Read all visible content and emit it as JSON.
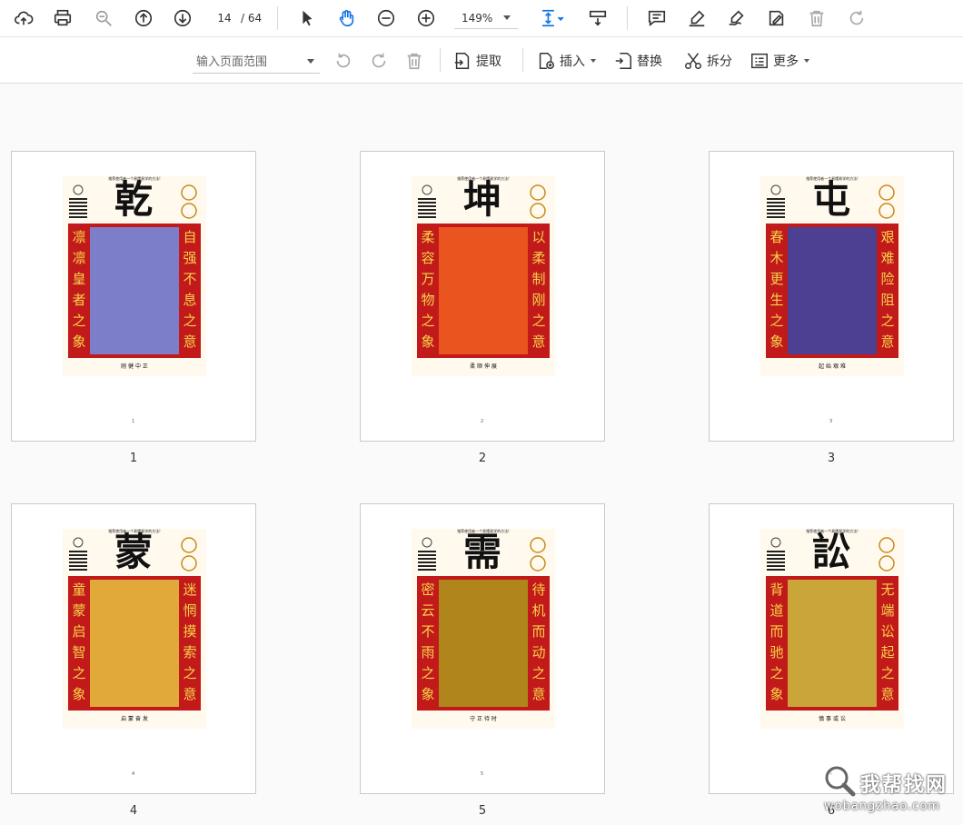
{
  "toolbar": {
    "page_current": "14",
    "page_total": "/ 64",
    "zoom": "149%"
  },
  "edit_toolbar": {
    "range_placeholder": "输入页面范围",
    "extract": "提取",
    "insert": "插入",
    "replace": "替换",
    "split": "拆分",
    "more": "更多"
  },
  "thumbnails": [
    {
      "label": "1",
      "top_text": "推荐使用者一个易懂易学的方法!",
      "big": "乾",
      "left": [
        "凛",
        "凛",
        "皇",
        "者",
        "之",
        "象"
      ],
      "right": [
        "自",
        "强",
        "不",
        "息",
        "之",
        "意"
      ],
      "bottom": "刚 健 中 正",
      "tiny": "1",
      "scene_color": "#7d7ec9"
    },
    {
      "label": "2",
      "top_text": "推荐使用者一个易懂易学的方法!",
      "big": "坤",
      "left": [
        "柔",
        "容",
        "万",
        "物",
        "之",
        "象"
      ],
      "right": [
        "以",
        "柔",
        "制",
        "刚",
        "之",
        "意"
      ],
      "bottom": "柔 顺 伸 展",
      "tiny": "2",
      "scene_color": "#e9541f"
    },
    {
      "label": "3",
      "top_text": "推荐使用者一个易懂易学的方法!",
      "big": "屯",
      "left": [
        "春",
        "木",
        "更",
        "生",
        "之",
        "象"
      ],
      "right": [
        "艰",
        "难",
        "险",
        "阻",
        "之",
        "意"
      ],
      "bottom": "起 始 艰 难",
      "tiny": "3",
      "scene_color": "#4d3f91"
    },
    {
      "label": "4",
      "top_text": "推荐使用者一个易懂易学的方法!",
      "big": "蒙",
      "left": [
        "童",
        "蒙",
        "启",
        "智",
        "之",
        "象"
      ],
      "right": [
        "迷",
        "惘",
        "摸",
        "索",
        "之",
        "意"
      ],
      "bottom": "启 蒙 奋 发",
      "tiny": "4",
      "scene_color": "#e0a93a"
    },
    {
      "label": "5",
      "top_text": "推荐使用者一个易懂易学的方法!",
      "big": "需",
      "left": [
        "密",
        "云",
        "不",
        "雨",
        "之",
        "象"
      ],
      "right": [
        "待",
        "机",
        "而",
        "动",
        "之",
        "意"
      ],
      "bottom": "守 正 待 时",
      "tiny": "5",
      "scene_color": "#b0861c"
    },
    {
      "label": "6",
      "top_text": "推荐使用者一个易懂易学的方法!",
      "big": "訟",
      "left": [
        "背",
        "道",
        "而",
        "驰",
        "之",
        "象"
      ],
      "right": [
        "无",
        "端",
        "讼",
        "起",
        "之",
        "意"
      ],
      "bottom": "慎 事 或 讼",
      "tiny": "6",
      "scene_color": "#c9a53a"
    }
  ],
  "watermark": {
    "text": "我帮找网",
    "url": "wobangzhao.com"
  }
}
